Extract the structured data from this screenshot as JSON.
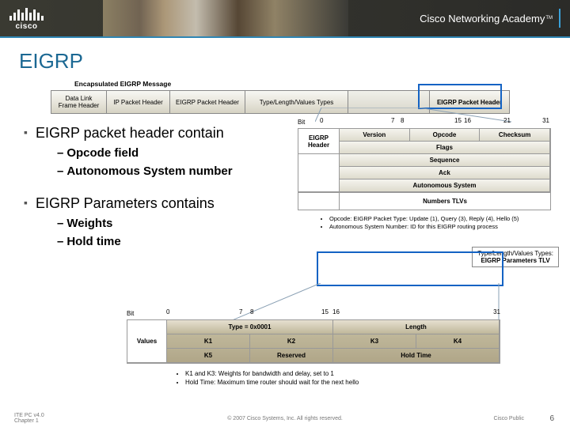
{
  "brand": {
    "name": "cisco",
    "academy": "Cisco Networking Academy",
    "tm": "TM"
  },
  "title": "EIGRP",
  "encap": {
    "label": "Encapsulated EIGRP Message",
    "cells": {
      "c1a": "Data Link",
      "c1b": "Frame Header",
      "c2": "IP Packet Header",
      "c3": "EIGRP Packet Header",
      "c4": "Type/Length/Values Types",
      "c5": "EIGRP Packet Header"
    }
  },
  "bullets": {
    "b1": "EIGRP packet header contain",
    "b1a": "Opcode field",
    "b1b": "Autonomous System number",
    "b2": "EIGRP Parameters contains",
    "b2a": "Weights",
    "b2b": "Hold time"
  },
  "hdr": {
    "bit": "Bit",
    "nums": {
      "n0": "0",
      "n7": "7",
      "n8": "8",
      "n15": "15",
      "n16": "16",
      "n21": "21",
      "n31": "31"
    },
    "side1": "EIGRP",
    "side2": "Header",
    "r1a": "Version",
    "r1b": "Opcode",
    "r1c": "Checksum",
    "r2": "Flags",
    "r3": "Sequence",
    "r4": "Ack",
    "r5": "Autonomous System",
    "side3": "",
    "tlv": "Numbers TLVs",
    "notes": {
      "n1": "Opcode: EIGRP Packet Type: Update (1), Query (3), Reply (4), Hello (5)",
      "n2": "Autonomous System Number: ID for this EIGRP routing process"
    }
  },
  "tlvbox": {
    "l1": "Type/Length/Values Types:",
    "l2": "EIGRP Parameters TLV"
  },
  "tlv": {
    "bit": "Bit",
    "nums": {
      "n0": "0",
      "n7": "7",
      "n8": "8",
      "n15": "15",
      "n16": "16",
      "n31": "31"
    },
    "side": "Values",
    "r1a": "Type = 0x0001",
    "r1b": "Length",
    "r2a": "K1",
    "r2b": "K2",
    "r2c": "K3",
    "r2d": "K4",
    "r3a": "K5",
    "r3b": "Reserved",
    "r3c": "Hold Time",
    "notes": {
      "n1": "K1 and K3: Weights for bandwidth and delay, set to 1",
      "n2": "Hold Time: Maximum time router should wait for the next hello"
    }
  },
  "footer": {
    "left1": "ITE PC v4.0",
    "left2": "Chapter 1",
    "mid": "© 2007 Cisco Systems, Inc. All rights reserved.",
    "right": "Cisco Public",
    "page": "6"
  }
}
